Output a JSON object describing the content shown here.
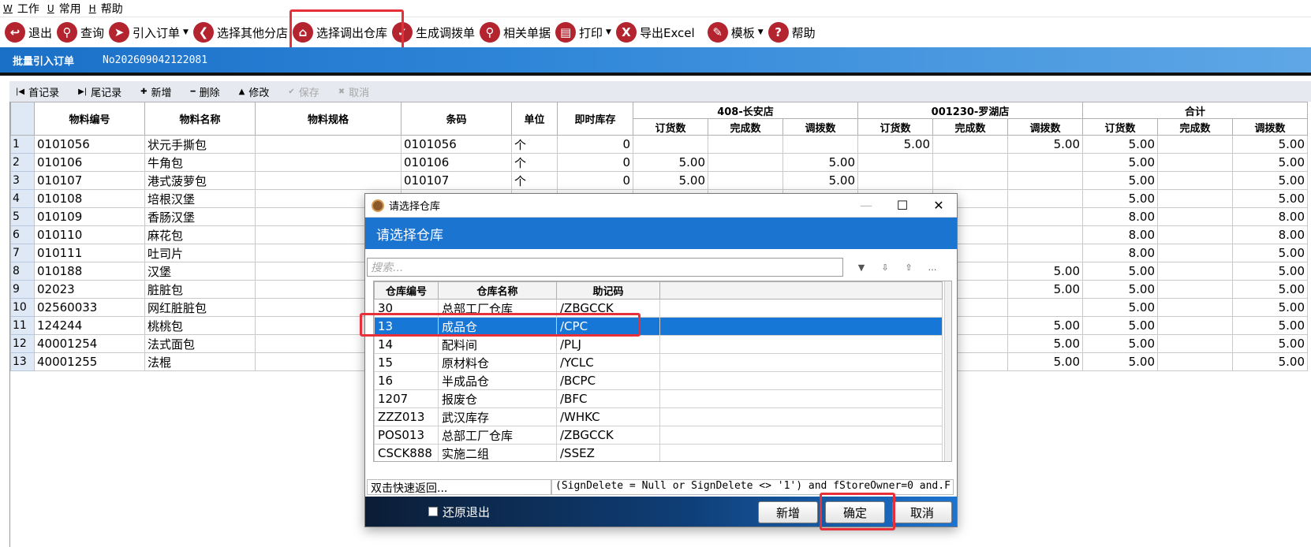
{
  "menubar": [
    {
      "key": "W",
      "label": "工作"
    },
    {
      "key": "U",
      "label": "常用"
    },
    {
      "key": "H",
      "label": "帮助"
    }
  ],
  "toolbar": {
    "exit": "退出",
    "query": "查询",
    "import_order": "引入订单",
    "select_branch": "选择其他分店",
    "select_warehouse": "选择调出仓库",
    "generate": "生成调拨单",
    "related": "相关单据",
    "print": "打印",
    "export": "导出Excel",
    "template": "模板",
    "help": "帮助"
  },
  "titlebar": {
    "title": "批量引入订单",
    "number": "No202609042122081"
  },
  "gridtools": {
    "first": "首记录",
    "last": "尾记录",
    "add": "新增",
    "delete": "删除",
    "edit": "修改",
    "save": "保存",
    "cancel": "取消"
  },
  "table": {
    "headers": {
      "code": "物料编号",
      "name": "物料名称",
      "spec": "物料规格",
      "barcode": "条码",
      "unit": "单位",
      "stock": "即时库存"
    },
    "groups": [
      "408-长安店",
      "001230-罗湖店",
      "合计"
    ],
    "sub": [
      "订货数",
      "完成数",
      "调拨数"
    ],
    "rows": [
      {
        "n": "1",
        "code": "0101056",
        "name": "状元手撕包",
        "barcode": "0101056",
        "unit": "个",
        "stock": "0",
        "a1": "",
        "a2": "",
        "a3": "",
        "b1": "5.00",
        "b2": "",
        "b3": "5.00",
        "c1": "5.00",
        "c2": "",
        "c3": "5.00"
      },
      {
        "n": "2",
        "code": "010106",
        "name": "牛角包",
        "barcode": "010106",
        "unit": "个",
        "stock": "0",
        "a1": "5.00",
        "a2": "",
        "a3": "5.00",
        "b1": "",
        "b2": "",
        "b3": "",
        "c1": "5.00",
        "c2": "",
        "c3": "5.00"
      },
      {
        "n": "3",
        "code": "010107",
        "name": "港式菠萝包",
        "barcode": "010107",
        "unit": "个",
        "stock": "0",
        "a1": "5.00",
        "a2": "",
        "a3": "5.00",
        "b1": "",
        "b2": "",
        "b3": "",
        "c1": "5.00",
        "c2": "",
        "c3": "5.00"
      },
      {
        "n": "4",
        "code": "010108",
        "name": "培根汉堡",
        "barcode": "",
        "unit": "",
        "stock": "",
        "a1": "",
        "a2": "",
        "a3": "",
        "b1": "",
        "b2": "",
        "b3": "",
        "c1": "5.00",
        "c2": "",
        "c3": "5.00"
      },
      {
        "n": "5",
        "code": "010109",
        "name": "香肠汉堡",
        "barcode": "",
        "unit": "",
        "stock": "",
        "a1": "",
        "a2": "",
        "a3": "",
        "b1": "",
        "b2": "",
        "b3": "",
        "c1": "8.00",
        "c2": "",
        "c3": "8.00"
      },
      {
        "n": "6",
        "code": "010110",
        "name": "麻花包",
        "barcode": "",
        "unit": "",
        "stock": "",
        "a1": "",
        "a2": "",
        "a3": "",
        "b1": "",
        "b2": "",
        "b3": "",
        "c1": "8.00",
        "c2": "",
        "c3": "8.00"
      },
      {
        "n": "7",
        "code": "010111",
        "name": "吐司片",
        "barcode": "",
        "unit": "",
        "stock": "",
        "a1": "",
        "a2": "",
        "a3": "",
        "b1": "",
        "b2": "",
        "b3": "",
        "c1": "8.00",
        "c2": "",
        "c3": "5.00"
      },
      {
        "n": "8",
        "code": "010188",
        "name": "汉堡",
        "barcode": "",
        "unit": "",
        "stock": "",
        "a1": "",
        "a2": "",
        "a3": "",
        "b1": "",
        "b2": "",
        "b3": "5.00",
        "c1": "5.00",
        "c2": "",
        "c3": "5.00"
      },
      {
        "n": "9",
        "code": "02023",
        "name": "脏脏包",
        "barcode": "",
        "unit": "",
        "stock": "",
        "a1": "",
        "a2": "",
        "a3": "",
        "b1": "",
        "b2": "",
        "b3": "5.00",
        "c1": "5.00",
        "c2": "",
        "c3": "5.00"
      },
      {
        "n": "10",
        "code": "02560033",
        "name": "网红脏脏包",
        "barcode": "",
        "unit": "",
        "stock": "",
        "a1": "",
        "a2": "",
        "a3": "",
        "b1": "",
        "b2": "",
        "b3": "",
        "c1": "5.00",
        "c2": "",
        "c3": "5.00"
      },
      {
        "n": "11",
        "code": "124244",
        "name": "桃桃包",
        "barcode": "",
        "unit": "",
        "stock": "",
        "a1": "",
        "a2": "",
        "a3": "",
        "b1": "",
        "b2": "",
        "b3": "5.00",
        "c1": "5.00",
        "c2": "",
        "c3": "5.00"
      },
      {
        "n": "12",
        "code": "40001254",
        "name": "法式面包",
        "barcode": "",
        "unit": "",
        "stock": "",
        "a1": "",
        "a2": "",
        "a3": "",
        "b1": "",
        "b2": "",
        "b3": "5.00",
        "c1": "5.00",
        "c2": "",
        "c3": "5.00"
      },
      {
        "n": "13",
        "code": "40001255",
        "name": "法棍",
        "barcode": "",
        "unit": "",
        "stock": "",
        "a1": "",
        "a2": "",
        "a3": "",
        "b1": "",
        "b2": "",
        "b3": "5.00",
        "c1": "5.00",
        "c2": "",
        "c3": "5.00"
      }
    ]
  },
  "dialog": {
    "title": "请选择仓库",
    "header": "请选择仓库",
    "search_placeholder": "搜索...",
    "columns": [
      "仓库编号",
      "仓库名称",
      "助记码"
    ],
    "rows": [
      [
        "30",
        "总部工厂仓库",
        "/ZBGCCK"
      ],
      [
        "13",
        "成品仓",
        "/CPC"
      ],
      [
        "14",
        "配料间",
        "/PLJ"
      ],
      [
        "15",
        "原材料仓",
        "/YCLC"
      ],
      [
        "16",
        "半成品仓",
        "/BCPC"
      ],
      [
        "1207",
        "报废仓",
        "/BFC"
      ],
      [
        "ZZZ013",
        "武汉库存",
        "/WHKC"
      ],
      [
        "POS013",
        "总部工厂仓库",
        "/ZBGCCK"
      ],
      [
        "CSCK888",
        "实施二组",
        "/SSEZ"
      ]
    ],
    "selected_index": 1,
    "status_left": "双击快速返回...",
    "status_right": "(SignDelete = Null or SignDelete <> '1') and fStoreOwner=0 and.F",
    "checkbox_label": "还原退出",
    "btn_new": "新增",
    "btn_ok": "确定",
    "btn_cancel": "取消"
  },
  "colors": {
    "accent": "#1b74d0",
    "highlight": "#e8303a",
    "icon": "#b3242f"
  }
}
